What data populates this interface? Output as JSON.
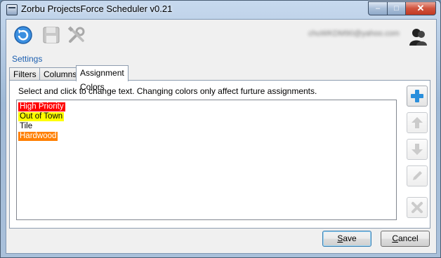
{
  "window": {
    "title": "Zorbu ProjectsForce Scheduler v0.21",
    "minimize_glyph": "–",
    "maximize_glyph": "□",
    "close_glyph": "✕"
  },
  "toolbar": {
    "refresh_icon": "refresh-icon",
    "save_icon": "save-disk-icon",
    "tools_icon": "tools-icon",
    "user_email": "chuWKDM90@yahoo.com",
    "user_icon": "user-icon"
  },
  "settings_link": "Settings",
  "tabs": [
    {
      "label": "Filters",
      "active": false
    },
    {
      "label": "Columns",
      "active": false
    },
    {
      "label": "Assignment Colors",
      "active": true
    }
  ],
  "panel": {
    "hint": "Select and click to change text.  Changing colors only affect furture assignments.",
    "items": [
      {
        "label": "High Priority",
        "bg": "#ff0000",
        "fg": "#ffffff"
      },
      {
        "label": "Out of Town",
        "bg": "#ffff00",
        "fg": "#000000"
      },
      {
        "label": "Tile",
        "bg": "#ffffff",
        "fg": "#000000"
      },
      {
        "label": "Hardwood",
        "bg": "#ff7f00",
        "fg": "#ffffff"
      }
    ]
  },
  "side_buttons": [
    {
      "name": "add-button",
      "icon": "plus-icon",
      "enabled": true
    },
    {
      "name": "move-up-button",
      "icon": "arrow-up-icon",
      "enabled": false
    },
    {
      "name": "move-down-button",
      "icon": "arrow-down-icon",
      "enabled": false
    },
    {
      "name": "edit-button",
      "icon": "pencil-icon",
      "enabled": false
    },
    {
      "name": "delete-button",
      "icon": "x-icon",
      "enabled": false
    }
  ],
  "buttons": {
    "save_prefix": "",
    "save_mnemonic": "S",
    "save_rest": "ave",
    "cancel_prefix": "",
    "cancel_mnemonic": "C",
    "cancel_rest": "ancel"
  },
  "colors": {
    "accent": "#1c5fb0",
    "plus_blue": "#2a8fdc"
  }
}
